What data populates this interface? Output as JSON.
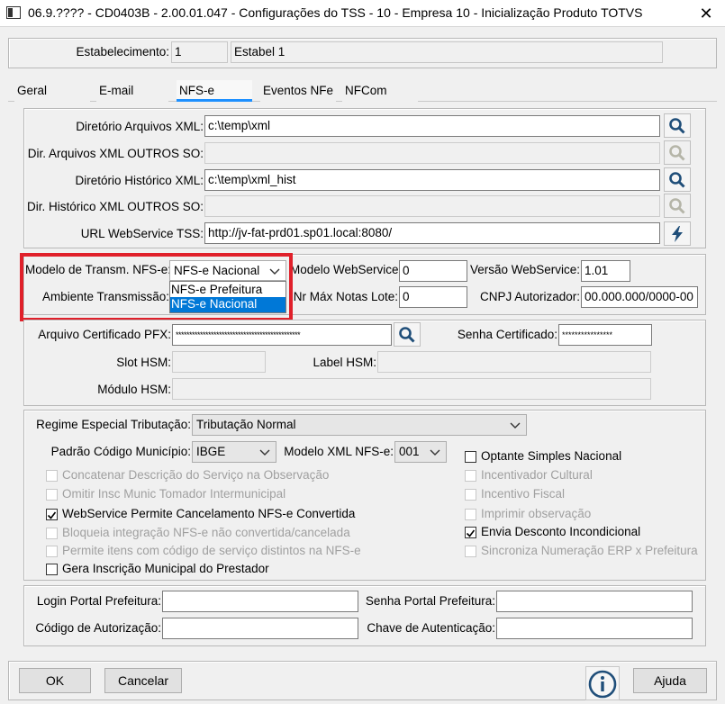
{
  "window": {
    "title": "06.9.???? - CD0403B - 2.00.01.047 - Configurações do TSS - 10 - Empresa 10 - Inicialização Produto TOTVS",
    "close": "✕"
  },
  "estabelecimento": {
    "label": "Estabelecimento:",
    "code": "1",
    "name": "Estabel 1"
  },
  "tabs": [
    "Geral",
    "E-mail",
    "NFS-e",
    "Eventos NFe",
    "NFCom"
  ],
  "active_tab": "NFS-e",
  "dirs": {
    "xml_label": "Diretório Arquivos XML:",
    "xml_value": "c:\\temp\\xml",
    "xml_other_label": "Dir. Arquivos XML OUTROS SO:",
    "hist_label": "Diretório Histórico XML:",
    "hist_value": "c:\\temp\\xml_hist",
    "hist_other_label": "Dir. Histórico XML OUTROS SO:",
    "url_label": "URL WebService TSS:",
    "url_value": "http://jv-fat-prd01.sp01.local:8080/"
  },
  "transm": {
    "modelo_label": "Modelo de Transm. NFS-e:",
    "modelo_value": "NFS-e Nacional",
    "options": [
      "NFS-e Prefeitura",
      "NFS-e Nacional"
    ],
    "selected_option": "NFS-e Nacional",
    "ambiente_label": "Ambiente Transmissão:",
    "modelo_ws_label": "Modelo WebService:",
    "modelo_ws_value": "0",
    "versao_ws_label": "Versão WebService:",
    "versao_ws_value": "1.01",
    "nr_max_label": "Nr Máx Notas Lote:",
    "nr_max_value": "0",
    "cnpj_label": "CNPJ Autorizador:",
    "cnpj_value": "00.000.000/0000-00"
  },
  "cert": {
    "pfx_label": "Arquivo Certificado PFX:",
    "pfx_value": "**********************************************",
    "senha_label": "Senha Certificado:",
    "senha_value": "****************",
    "slot_label": "Slot HSM:",
    "label_hsm_label": "Label HSM:",
    "modulo_label": "Módulo HSM:"
  },
  "regime": {
    "regime_label": "Regime Especial Tributação:",
    "regime_value": "Tributação Normal",
    "padrao_label": "Padrão Código Município:",
    "padrao_value": "IBGE",
    "modelo_xml_label": "Modelo XML NFS-e:",
    "modelo_xml_value": "001"
  },
  "checks_left": [
    {
      "label": "Concatenar Descrição do Serviço na Observação",
      "checked": false,
      "enabled": false
    },
    {
      "label": "Omitir Insc Munic Tomador Intermunicipal",
      "checked": false,
      "enabled": false
    },
    {
      "label": "WebService Permite Cancelamento NFS-e Convertida",
      "checked": true,
      "enabled": true
    },
    {
      "label": "Bloqueia integração NFS-e não convertida/cancelada",
      "checked": false,
      "enabled": false
    },
    {
      "label": "Permite itens com código de serviço distintos na NFS-e",
      "checked": false,
      "enabled": false
    },
    {
      "label": "Gera Inscrição Municipal do Prestador",
      "checked": false,
      "enabled": true
    }
  ],
  "checks_right": [
    {
      "label": "Optante Simples Nacional",
      "checked": false,
      "enabled": true
    },
    {
      "label": "Incentivador Cultural",
      "checked": false,
      "enabled": false
    },
    {
      "label": "Incentivo Fiscal",
      "checked": false,
      "enabled": false
    },
    {
      "label": "Imprimir observação",
      "checked": false,
      "enabled": false
    },
    {
      "label": "Envia Desconto Incondicional",
      "checked": true,
      "enabled": true
    },
    {
      "label": "Sincroniza Numeração ERP x Prefeitura",
      "checked": false,
      "enabled": false
    }
  ],
  "portal": {
    "login_label": "Login Portal Prefeitura:",
    "senha_label": "Senha Portal Prefeitura:",
    "codigo_label": "Código de Autorização:",
    "chave_label": "Chave de Autenticação:"
  },
  "buttons": {
    "ok": "OK",
    "cancel": "Cancelar",
    "help": "Ajuda"
  },
  "colors": {
    "highlight": "#0078d7",
    "annotation": "#e0202a",
    "tab_underline": "#1e90ff"
  }
}
